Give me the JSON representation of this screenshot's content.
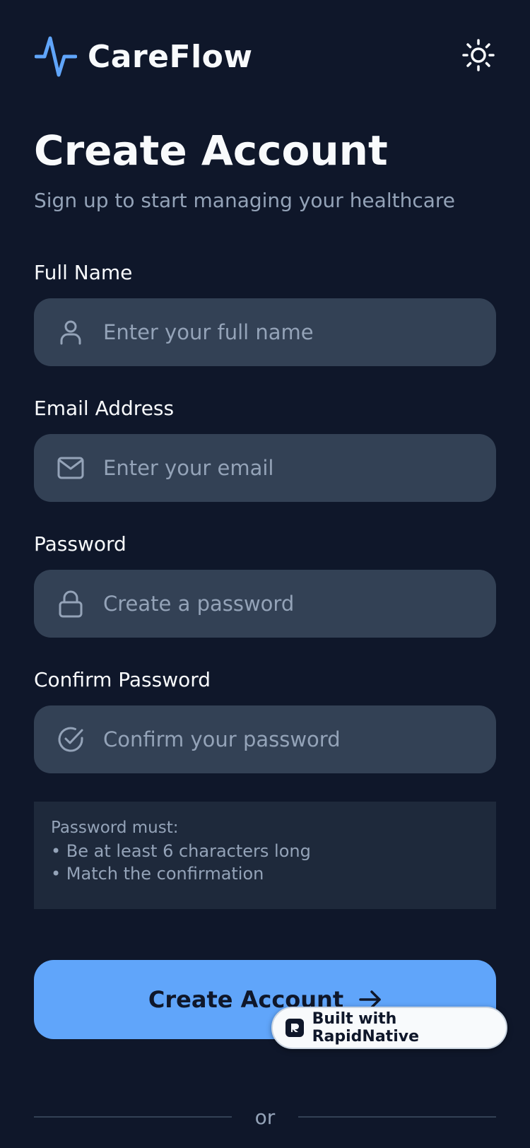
{
  "app": {
    "name": "CareFlow",
    "accent_color": "#60a5fa",
    "logo_icon": "pulse-icon",
    "theme_toggle_icon": "sun-icon"
  },
  "page": {
    "title": "Create Account",
    "subtitle": "Sign up to start managing your healthcare"
  },
  "form": {
    "full_name": {
      "label": "Full Name",
      "placeholder": "Enter your full name",
      "value": "",
      "icon": "user-icon"
    },
    "email": {
      "label": "Email Address",
      "placeholder": "Enter your email",
      "value": "",
      "icon": "mail-icon"
    },
    "password": {
      "label": "Password",
      "placeholder": "Create a password",
      "value": "",
      "icon": "lock-icon"
    },
    "confirm_password": {
      "label": "Confirm Password",
      "placeholder": "Confirm your password",
      "value": "",
      "icon": "check-circle-icon"
    }
  },
  "requirements": {
    "title": "Password must:",
    "items": [
      "• Be at least 6 characters long",
      "• Match the confirmation"
    ]
  },
  "submit": {
    "label": "Create Account",
    "icon": "arrow-right-icon"
  },
  "badge": {
    "label": "Built with RapidNative"
  },
  "divider": {
    "label": "or"
  }
}
